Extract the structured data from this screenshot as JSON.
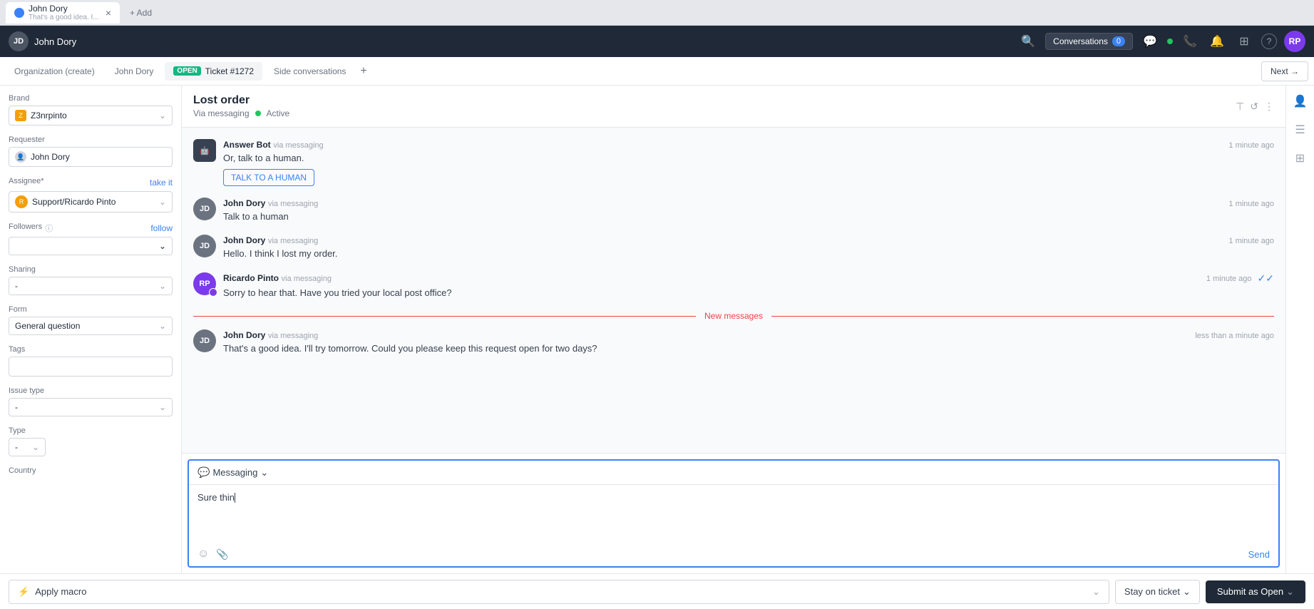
{
  "tab": {
    "favicon_color": "#3b82f6",
    "title": "John Dory",
    "subtitle": "That's a good idea. I...",
    "close_label": "×",
    "new_label": "+ Add"
  },
  "app_header": {
    "user_name": "John Dory",
    "avatar_initials": "JD",
    "conversations_label": "Conversations",
    "conversations_count": "0",
    "next_label": "Next →"
  },
  "sub_nav": {
    "tab_org": "Organization (create)",
    "tab_user": "John Dory",
    "badge_open": "OPEN",
    "tab_ticket": "Ticket #1272",
    "tab_side": "Side conversations",
    "add_label": "+",
    "next_label": "Next →"
  },
  "sidebar": {
    "brand_label": "Brand",
    "brand_value": "Z3nrpinto",
    "requester_label": "Requester",
    "requester_value": "John Dory",
    "assignee_label": "Assignee*",
    "assignee_value": "Support/Ricardo Pinto",
    "take_it_label": "take it",
    "followers_label": "Followers",
    "follow_label": "follow",
    "sharing_label": "Sharing",
    "sharing_value": "-",
    "form_label": "Form",
    "form_value": "General question",
    "tags_label": "Tags",
    "issue_type_label": "Issue type",
    "issue_type_value": "-",
    "type_label": "Type",
    "type_value": "-",
    "country_label": "Country"
  },
  "ticket": {
    "title": "Lost order",
    "via": "Via messaging",
    "status": "Active"
  },
  "messages": [
    {
      "sender": "Answer Bot",
      "via": "via messaging",
      "time": "1 minute ago",
      "text": "Or, talk to a human.",
      "button": "TALK TO A HUMAN",
      "avatar_type": "bot"
    },
    {
      "sender": "John Dory",
      "via": "via messaging",
      "time": "1 minute ago",
      "text": "Talk to a human",
      "avatar_type": "user"
    },
    {
      "sender": "John Dory",
      "via": "via messaging",
      "time": "1 minute ago",
      "text": "Hello. I think I lost my order.",
      "avatar_type": "user"
    },
    {
      "sender": "Ricardo Pinto",
      "via": "via messaging",
      "time": "1 minute ago",
      "text": "Sorry to hear that. Have you tried your local post office?",
      "avatar_type": "support"
    }
  ],
  "new_messages_divider": "New messages",
  "new_message": {
    "sender": "John Dory",
    "via": "via messaging",
    "time": "less than a minute ago",
    "text": "That's a good idea. I'll try tomorrow. Could you please keep this request open for two days?"
  },
  "reply": {
    "mode_label": "Messaging",
    "input_text": "Sure thin",
    "send_label": "Send"
  },
  "bottom": {
    "apply_macro_label": "Apply macro",
    "stay_on_ticket_label": "Stay on ticket",
    "submit_label": "Submit as Open"
  },
  "icons": {
    "search": "🔍",
    "chat": "💬",
    "phone": "📞",
    "bell": "🔔",
    "grid": "⊞",
    "help": "?",
    "filter": "⊤",
    "history": "↺",
    "more": "⋮",
    "person": "👤",
    "list": "☰",
    "apps": "⊞",
    "emoji": "☺",
    "attach": "📎",
    "chevron_down": "⌄",
    "chevron_right": "›",
    "lightning": "⚡",
    "check": "✓"
  }
}
